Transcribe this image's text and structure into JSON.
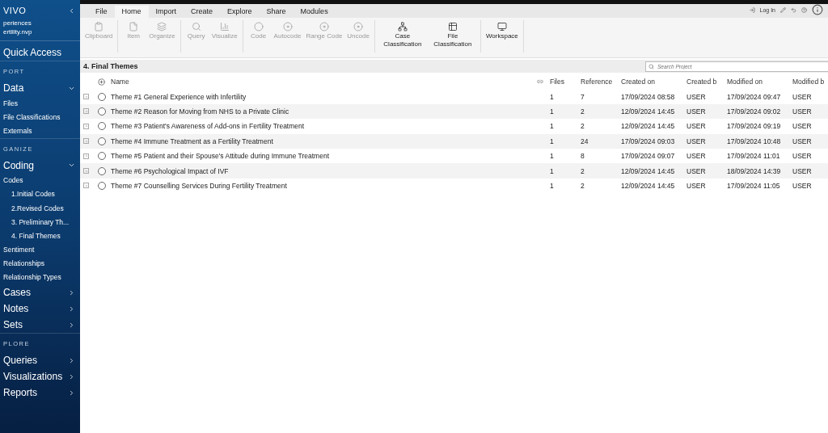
{
  "sidebar": {
    "logo": "VIVO",
    "project_lines": [
      "periences",
      "ertility.nvp"
    ],
    "items": [
      {
        "kind": "group",
        "label": "Quick Access"
      },
      {
        "kind": "section",
        "label": "PORT"
      },
      {
        "kind": "group",
        "label": "Data",
        "expanded": true
      },
      {
        "kind": "item",
        "label": "Files"
      },
      {
        "kind": "item",
        "label": "File Classifications"
      },
      {
        "kind": "item",
        "label": "Externals"
      },
      {
        "kind": "section",
        "label": "GANIZE"
      },
      {
        "kind": "group",
        "label": "Coding",
        "expanded": true
      },
      {
        "kind": "item",
        "label": "Codes"
      },
      {
        "kind": "subitem",
        "label": "1.Initial Codes"
      },
      {
        "kind": "subitem",
        "label": "2.Revised Codes"
      },
      {
        "kind": "subitem",
        "label": "3. Preliminary Th..."
      },
      {
        "kind": "subitem",
        "label": "4. Final Themes"
      },
      {
        "kind": "item",
        "label": "Sentiment"
      },
      {
        "kind": "item",
        "label": "Relationships"
      },
      {
        "kind": "item",
        "label": "Relationship Types"
      },
      {
        "kind": "group",
        "label": "Cases",
        "expanded": false
      },
      {
        "kind": "group",
        "label": "Notes",
        "expanded": false
      },
      {
        "kind": "group",
        "label": "Sets",
        "expanded": false
      },
      {
        "kind": "section",
        "label": "PLORE"
      },
      {
        "kind": "group",
        "label": "Queries",
        "expanded": false
      },
      {
        "kind": "group",
        "label": "Visualizations",
        "expanded": false
      },
      {
        "kind": "group",
        "label": "Reports",
        "expanded": false
      }
    ]
  },
  "menu_tabs": [
    {
      "label": "File",
      "selected": false
    },
    {
      "label": "Home",
      "selected": true
    },
    {
      "label": "Import",
      "selected": false
    },
    {
      "label": "Create",
      "selected": false
    },
    {
      "label": "Explore",
      "selected": false
    },
    {
      "label": "Share",
      "selected": false
    },
    {
      "label": "Modules",
      "selected": false
    }
  ],
  "login": "Log In",
  "ribbon_groups": [
    [
      {
        "label": "Clipboard",
        "disabled": true
      }
    ],
    [
      {
        "label": "Item",
        "disabled": true
      },
      {
        "label": "Organize",
        "disabled": true
      }
    ],
    [
      {
        "label": "Query",
        "disabled": true
      },
      {
        "label": "Visualize",
        "disabled": true
      }
    ],
    [
      {
        "label": "Code",
        "disabled": true
      },
      {
        "label": "Autocode",
        "disabled": true
      },
      {
        "label": "Range Code",
        "disabled": true
      },
      {
        "label": "Uncode",
        "disabled": true
      }
    ],
    [
      {
        "label": "Case Classification",
        "disabled": false
      },
      {
        "label": "File Classification",
        "disabled": false
      }
    ],
    [
      {
        "label": "Workspace",
        "disabled": false
      }
    ]
  ],
  "panel_title": "4. Final Themes",
  "search": {
    "placeholder": "Search Project"
  },
  "table": {
    "columns": [
      "Name",
      "Files",
      "Reference",
      "Created on",
      "Created b",
      "Modified on",
      "Modified b"
    ],
    "rows": [
      {
        "selected": false,
        "cells": [
          "Theme #1 General Experience with Infertility",
          "1",
          "7",
          "17/09/2024 08:58",
          "USER",
          "17/09/2024 09:47",
          "USER"
        ]
      },
      {
        "selected": false,
        "cells": [
          "Theme #2 Reason for Moving from NHS to a Private Clinic",
          "1",
          "2",
          "12/09/2024 14:45",
          "USER",
          "17/09/2024 09:02",
          "USER"
        ]
      },
      {
        "selected": false,
        "cells": [
          "Theme #3 Patient's Awareness of Add-ons in Fertility Treatment",
          "1",
          "2",
          "12/09/2024 14:45",
          "USER",
          "17/09/2024 09:19",
          "USER"
        ]
      },
      {
        "selected": false,
        "cells": [
          "Theme #4 Immune Treatment as a Fertility Treatment",
          "1",
          "24",
          "17/09/2024 09:03",
          "USER",
          "17/09/2024 10:48",
          "USER"
        ]
      },
      {
        "selected": false,
        "cells": [
          "Theme #5 Patient and their Spouse's Attitude during Immune Treatment",
          "1",
          "8",
          "17/09/2024 09:07",
          "USER",
          "17/09/2024 11:01",
          "USER"
        ]
      },
      {
        "selected": false,
        "cells": [
          "Theme #6 Psychological Impact of IVF",
          "1",
          "2",
          "12/09/2024 14:45",
          "USER",
          "18/09/2024 14:39",
          "USER"
        ]
      },
      {
        "selected": false,
        "cells": [
          "Theme #7  Counselling Services During Fertility Treatment",
          "1",
          "2",
          "12/09/2024 14:45",
          "USER",
          "17/09/2024 11:05",
          "USER"
        ]
      }
    ]
  }
}
